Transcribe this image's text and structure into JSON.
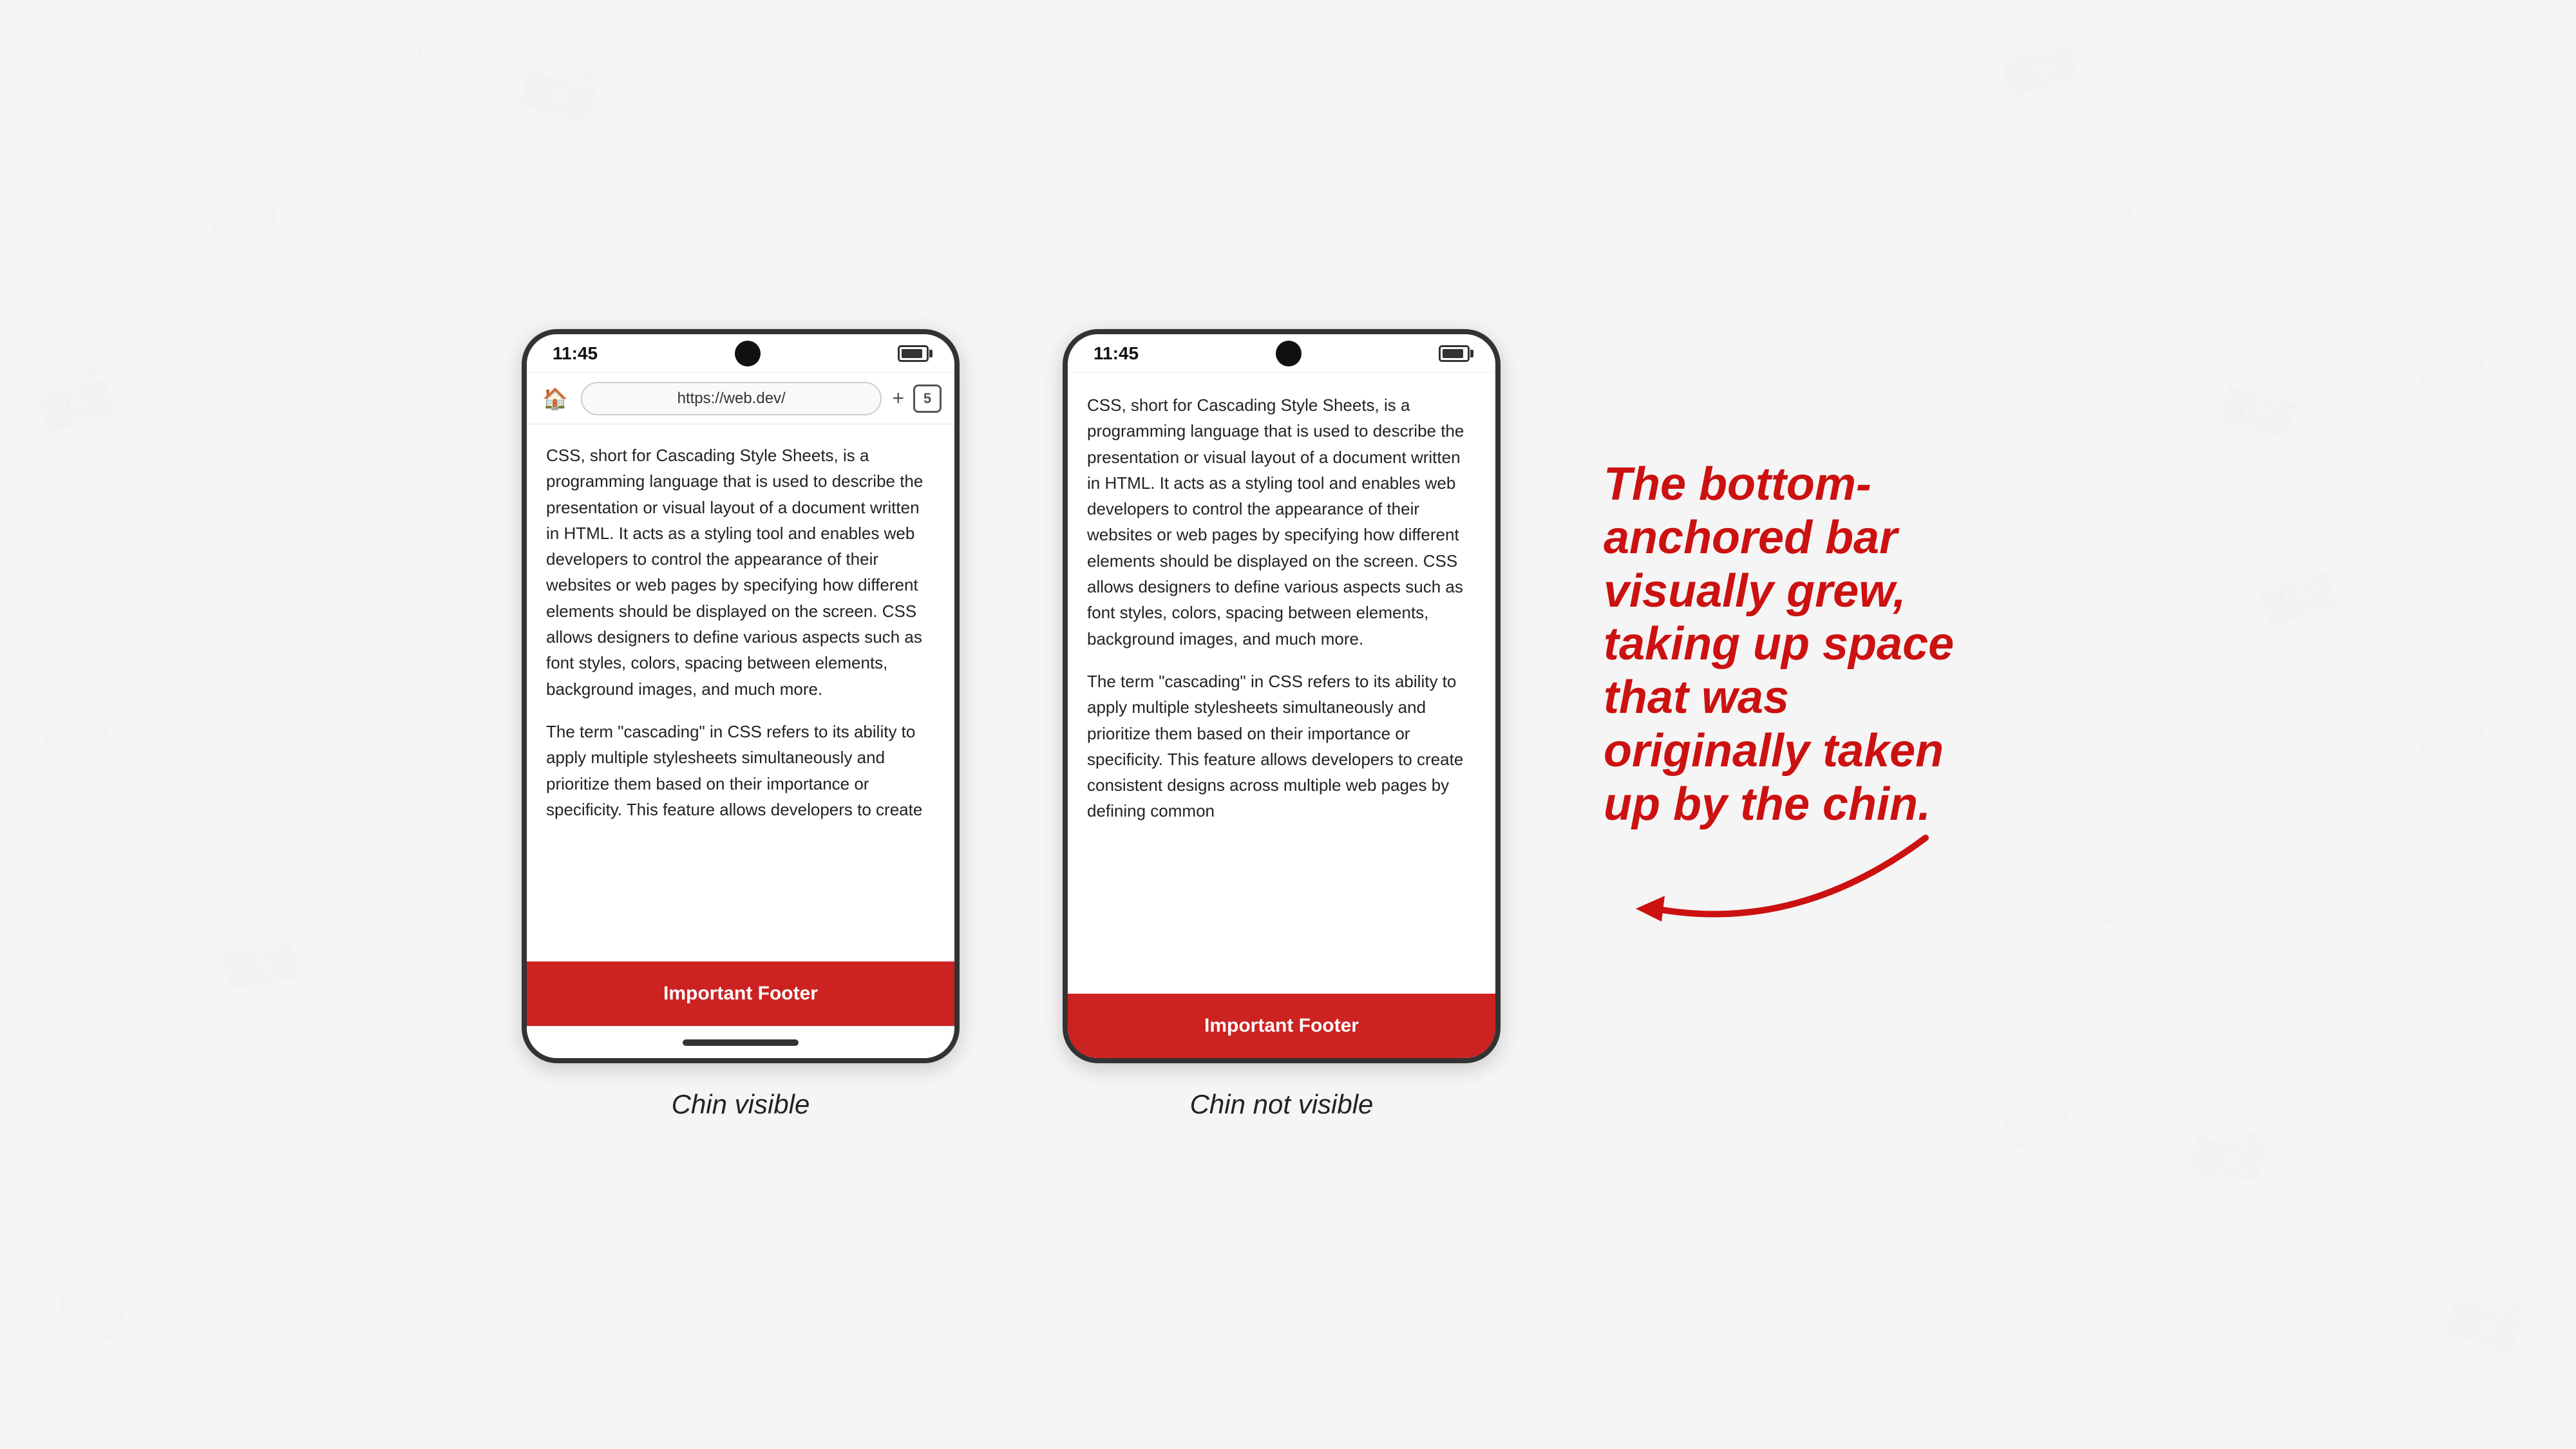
{
  "background": {
    "color": "#f0f0f0"
  },
  "phone_left": {
    "status_time": "11:45",
    "url": "https://web.dev/",
    "tab_count": "5",
    "content_paragraphs": [
      "CSS, short for Cascading Style Sheets, is a programming language that is used to describe the presentation or visual layout of a document written in HTML. It acts as a styling tool and enables web developers to control the appearance of their websites or web pages by specifying how different elements should be displayed on the screen. CSS allows designers to define various aspects such as font styles, colors, spacing between elements, background images, and much more.",
      "The term \"cascading\" in CSS refers to its ability to apply multiple stylesheets simultaneously and prioritize them based on their importance or specificity. This feature allows developers to create"
    ],
    "footer_label": "Important Footer",
    "caption": "Chin visible",
    "has_chin": true
  },
  "phone_right": {
    "status_time": "11:45",
    "content_paragraphs": [
      "CSS, short for Cascading Style Sheets, is a programming language that is used to describe the presentation or visual layout of a document written in HTML. It acts as a styling tool and enables web developers to control the appearance of their websites or web pages by specifying how different elements should be displayed on the screen. CSS allows designers to define various aspects such as font styles, colors, spacing between elements, background images, and much more.",
      "The term \"cascading\" in CSS refers to its ability to apply multiple stylesheets simultaneously and prioritize them based on their importance or specificity. This feature allows developers to create consistent designs across multiple web pages by defining common"
    ],
    "footer_label": "Important Footer",
    "caption": "Chin not visible",
    "has_chin": false
  },
  "annotation": {
    "line1": "The bottom-",
    "line2": "anchored bar",
    "line3": "visually grew,",
    "line4": "taking up space",
    "line5": "that was",
    "line6": "originally taken",
    "line7": "up by the chin."
  },
  "colors": {
    "footer_bg": "#cc2222",
    "annotation_color": "#cc1111",
    "phone_border": "#333333"
  }
}
